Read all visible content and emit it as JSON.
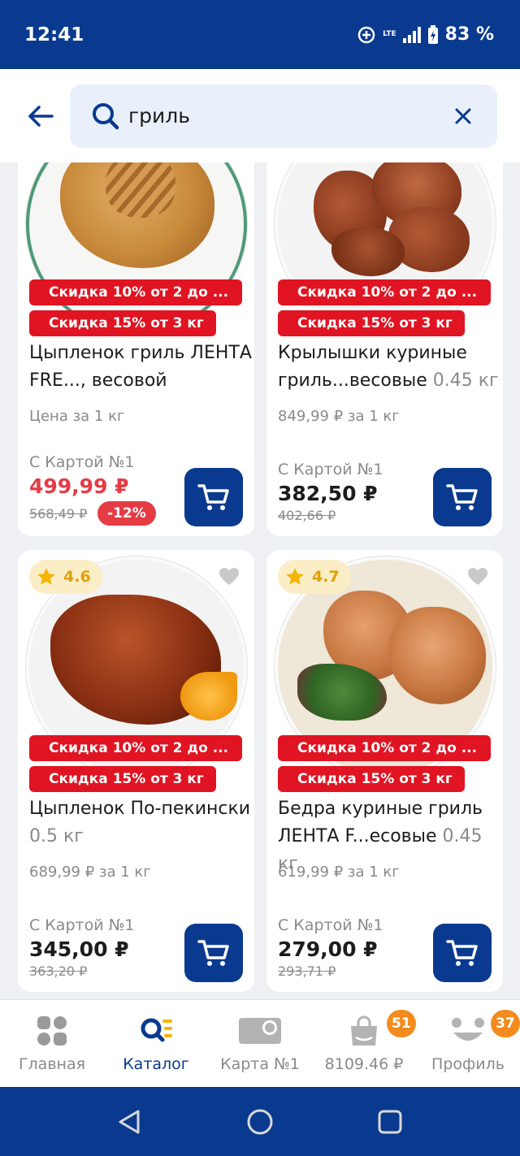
{
  "status_bar": {
    "time": "12:41",
    "network": "LTE",
    "battery": "83 %"
  },
  "search": {
    "value": "гриль",
    "placeholder": ""
  },
  "products": [
    {
      "promo1": "Скидка 10% от 2 до ...",
      "promo2": "Скидка 15% от 3 кг",
      "name": "Цыпленок гриль ЛЕНТА FRE..., весовой",
      "weight": "",
      "unit_price": "Цена за 1 кг",
      "card_label": "С Картой №1",
      "price": "499,99 ₽",
      "old_price": "568,49 ₽",
      "discount": "-12%"
    },
    {
      "promo1": "Скидка 10% от 2 до ...",
      "promo2": "Скидка 15% от 3 кг",
      "name": "Крылышки куриные гриль...весовые",
      "weight": "0.45 кг",
      "unit_price": "849,99 ₽ за 1 кг",
      "card_label": "С Картой №1",
      "price": "382,50 ₽",
      "old_price": "402,66 ₽"
    },
    {
      "rating": "4.6",
      "promo1": "Скидка 10% от 2 до ...",
      "promo2": "Скидка 15% от 3 кг",
      "name": "Цыпленок По-пекински",
      "weight": "0.5 кг",
      "unit_price": "689,99 ₽ за 1 кг",
      "card_label": "С Картой №1",
      "price": "345,00 ₽",
      "old_price": "363,20 ₽"
    },
    {
      "rating": "4.7",
      "promo1": "Скидка 10% от 2 до ...",
      "promo2": "Скидка 15% от 3 кг",
      "name": "Бедра куриные гриль ЛЕНТА F...есовые",
      "weight": "0.45 кг",
      "unit_price": "619,99 ₽ за 1 кг",
      "card_label": "С Картой №1",
      "price": "279,00 ₽",
      "old_price": "293,71 ₽"
    }
  ],
  "tabs": [
    {
      "label": "Главная",
      "icon": "home-tiles-icon"
    },
    {
      "label": "Каталог",
      "icon": "catalog-search-icon",
      "active": true
    },
    {
      "label": "Карта №1",
      "icon": "loyalty-card-icon"
    },
    {
      "label": "8109.46 ₽",
      "icon": "shopping-bag-icon",
      "badge": "51"
    },
    {
      "label": "Профиль",
      "icon": "profile-face-icon",
      "badge": "37"
    }
  ],
  "colors": {
    "brand_blue": "#0a3a8f",
    "promo_red": "#e01422",
    "price_red": "#e53b45",
    "badge_orange": "#f28c1e",
    "rating_yellow": "#f5b400"
  }
}
